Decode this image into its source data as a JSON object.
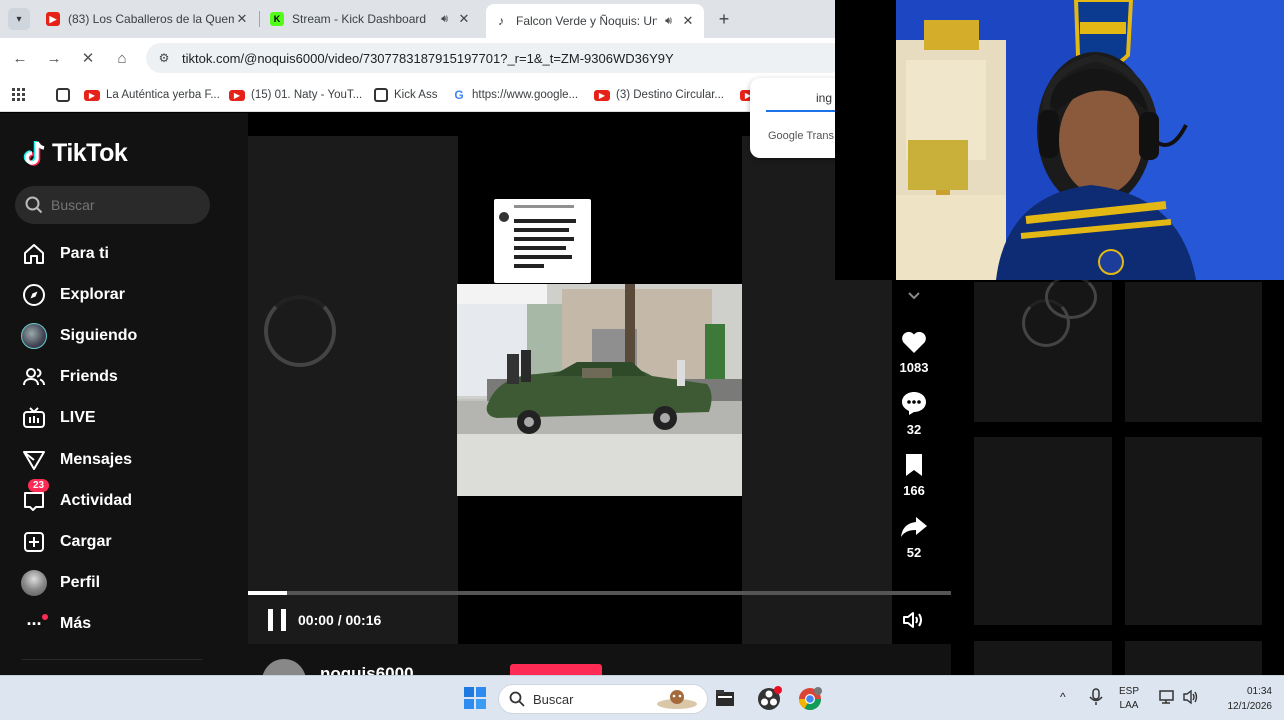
{
  "browser": {
    "tabs": [
      {
        "title": "(83) Los Caballeros de la Quema",
        "favicon": "youtube-icon",
        "has_audio": false
      },
      {
        "title": "Stream - Kick Dashboard",
        "favicon": "kick-icon",
        "has_audio": true
      },
      {
        "title": "Falcon Verde y Ñoquis: Un V",
        "favicon": "tiktok-icon",
        "has_audio": true,
        "active": true
      }
    ],
    "url": "tiktok.com/@noquis6000/video/7307783187915197701?_r=1&_t=ZM-9306WD36Y9Y",
    "bookmarks": [
      {
        "label": "La Auténtica yerba F...",
        "icon": "globe-icon"
      },
      {
        "label": "(15) 01. Naty - YouT...",
        "icon": "youtube-icon"
      },
      {
        "label": "Kick Ass",
        "icon": "globe-icon"
      },
      {
        "label": "https://www.google...",
        "icon": "google-icon"
      },
      {
        "label": "(3) Destino Circular...",
        "icon": "youtube-icon"
      }
    ],
    "translate_popup": {
      "tab": "ing",
      "brand": "Google Trans"
    }
  },
  "tiktok": {
    "logo_text": "TikTok",
    "search_placeholder": "Buscar",
    "nav": [
      {
        "label": "Para ti",
        "icon": "home-icon"
      },
      {
        "label": "Explorar",
        "icon": "compass-icon"
      },
      {
        "label": "Siguiendo",
        "icon": "following-avatar"
      },
      {
        "label": "Friends",
        "icon": "friends-icon"
      },
      {
        "label": "LIVE",
        "icon": "live-icon"
      },
      {
        "label": "Mensajes",
        "icon": "messages-icon"
      },
      {
        "label": "Actividad",
        "icon": "activity-icon",
        "badge": "23"
      },
      {
        "label": "Cargar",
        "icon": "upload-icon"
      },
      {
        "label": "Perfil",
        "icon": "profile-avatar"
      },
      {
        "label": "Más",
        "icon": "more-icon"
      }
    ],
    "video": {
      "current_time": "00:00",
      "duration": "00:16",
      "time_display": "00:00 / 00:16",
      "progress_fraction": 0.055
    },
    "actions": {
      "likes": "1083",
      "comments": "32",
      "saves": "166",
      "shares": "52"
    },
    "author": {
      "username": "noquis6000"
    },
    "accent_color": "#fe2c55"
  },
  "taskbar": {
    "search_label": "Buscar",
    "language": "ESP",
    "layout": "LAA",
    "time": "01:34",
    "date": "12/1/2026"
  }
}
